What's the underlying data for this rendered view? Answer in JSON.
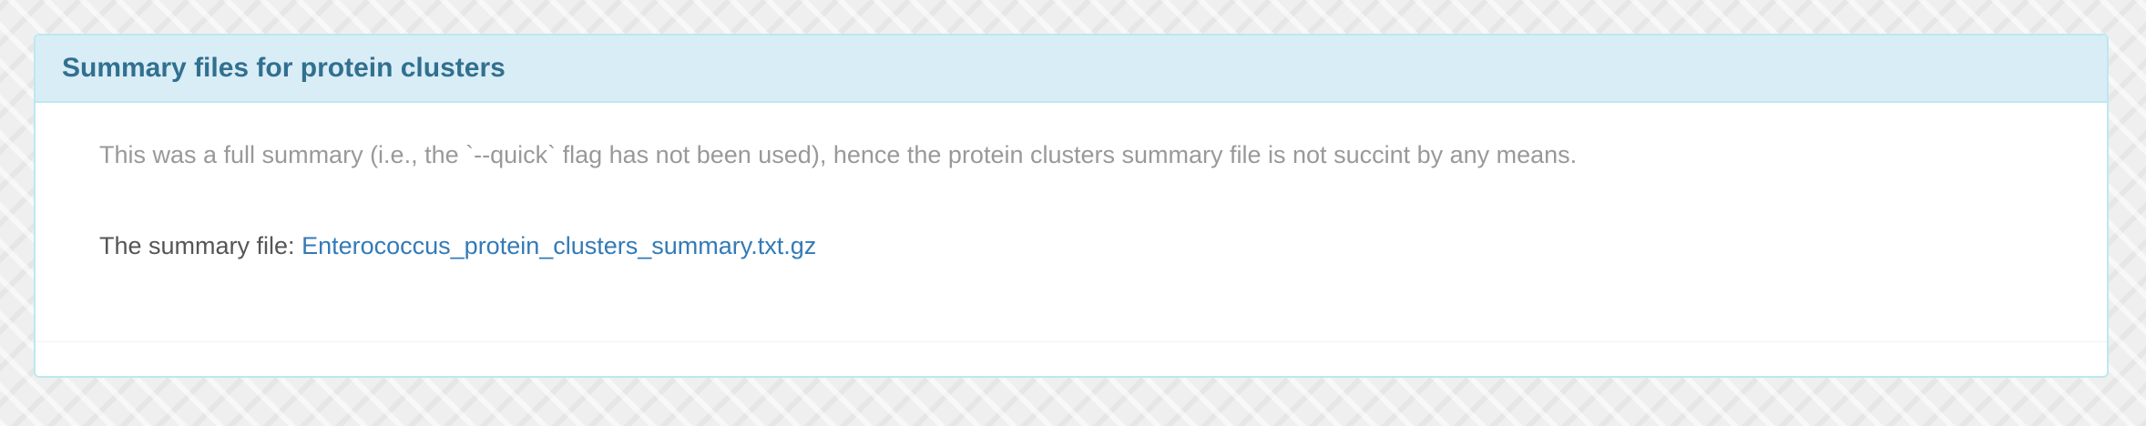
{
  "panel": {
    "title": "Summary files for protein clusters",
    "note": "This was a full summary (i.e., the `--quick` flag has not been used), hence the protein clusters summary file is not succint by any means.",
    "summary_label": "The summary file:",
    "summary_link": "Enterococcus_protein_clusters_summary.txt.gz"
  },
  "colors": {
    "heading_bg": "#d9edf7",
    "heading_text": "#31708f",
    "panel_border": "#bce8f1",
    "link": "#337ab7",
    "muted_text": "#999999"
  }
}
